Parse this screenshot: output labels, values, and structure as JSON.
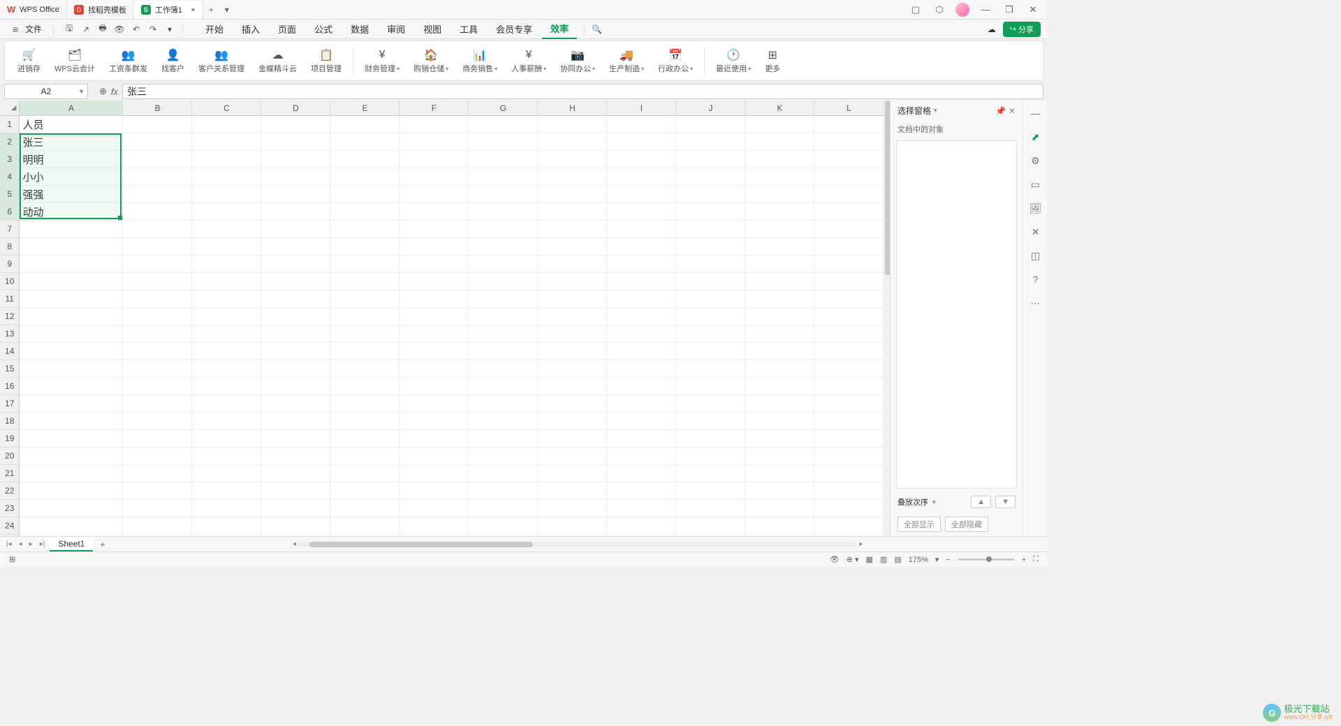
{
  "titlebar": {
    "tabs": [
      {
        "label": "WPS Office",
        "icon": "wps"
      },
      {
        "label": "找稻壳模板",
        "icon": "doc"
      },
      {
        "label": "工作簿1",
        "icon": "sheet",
        "modified": true
      }
    ],
    "windowButtons": [
      "▢",
      "⬡",
      "👤",
      "—",
      "❐",
      "✕"
    ]
  },
  "menubar": {
    "fileLabel": "文件",
    "tabs": [
      "开始",
      "插入",
      "页面",
      "公式",
      "数据",
      "审阅",
      "视图",
      "工具",
      "会员专享",
      "效率"
    ],
    "activeTab": "效率",
    "shareLabel": "分享"
  },
  "ribbon": [
    {
      "label": "进销存",
      "icon": "🛒"
    },
    {
      "label": "WPS云会计",
      "icon": "🗂"
    },
    {
      "label": "工资条群发",
      "icon": "👥"
    },
    {
      "label": "找客户",
      "icon": "👤"
    },
    {
      "label": "客户关系管理",
      "icon": "👥"
    },
    {
      "label": "金蝶精斗云",
      "icon": "☁"
    },
    {
      "label": "项目管理",
      "icon": "📋",
      "sep": true
    },
    {
      "label": "财务管理",
      "icon": "¥",
      "dd": true
    },
    {
      "label": "购销仓储",
      "icon": "🏠",
      "dd": true
    },
    {
      "label": "商务销售",
      "icon": "📊",
      "dd": true
    },
    {
      "label": "人事薪酬",
      "icon": "¥",
      "dd": true
    },
    {
      "label": "协同办公",
      "icon": "📷",
      "dd": true
    },
    {
      "label": "生产制造",
      "icon": "🚚",
      "dd": true
    },
    {
      "label": "行政办公",
      "icon": "📅",
      "dd": true,
      "sep": true
    },
    {
      "label": "最近使用",
      "icon": "🕐",
      "dd": true
    },
    {
      "label": "更多",
      "icon": "⊞"
    }
  ],
  "formulaBar": {
    "nameBox": "A2",
    "value": "张三"
  },
  "grid": {
    "columns": [
      "A",
      "B",
      "C",
      "D",
      "E",
      "F",
      "G",
      "H",
      "I",
      "J",
      "K",
      "L"
    ],
    "rowCount": 24,
    "data": {
      "A1": "人员",
      "A2": "张三",
      "A3": "明明",
      "A4": "小小",
      "A5": "强强",
      "A6": "动动"
    },
    "selectedCol": "A",
    "selectedRows": [
      2,
      3,
      4,
      5,
      6
    ],
    "activeCell": "A2"
  },
  "rightPanel": {
    "title": "选择窗格",
    "subtitle": "文档中的对象",
    "footerLabel": "叠放次序",
    "btnShowAll": "全部显示",
    "btnHideAll": "全部隐藏"
  },
  "sheetTabs": {
    "active": "Sheet1"
  },
  "statusBar": {
    "zoom": "175%"
  },
  "watermark": {
    "text": "极光下载站",
    "sub": "www.OH.分享.lyft"
  }
}
